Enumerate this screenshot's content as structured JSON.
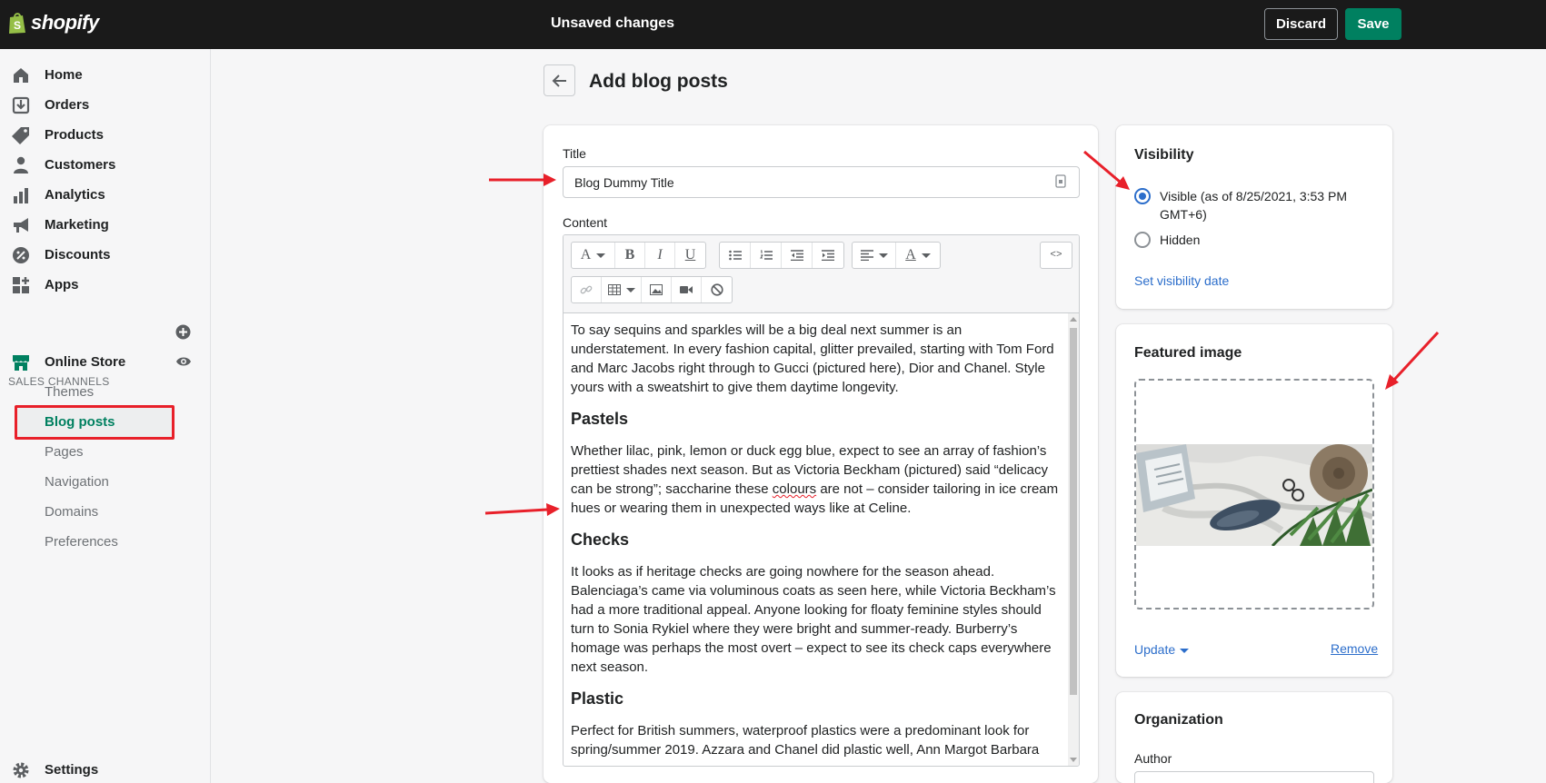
{
  "topbar": {
    "logo_text": "shopify",
    "status": "Unsaved changes",
    "discard_label": "Discard",
    "save_label": "Save"
  },
  "sidebar": {
    "items": [
      {
        "label": "Home",
        "icon": "home-icon"
      },
      {
        "label": "Orders",
        "icon": "orders-icon"
      },
      {
        "label": "Products",
        "icon": "tag-icon"
      },
      {
        "label": "Customers",
        "icon": "person-icon"
      },
      {
        "label": "Analytics",
        "icon": "bar-chart-icon"
      },
      {
        "label": "Marketing",
        "icon": "megaphone-icon"
      },
      {
        "label": "Discounts",
        "icon": "discount-icon"
      },
      {
        "label": "Apps",
        "icon": "apps-icon"
      }
    ],
    "sales_channels_label": "SALES CHANNELS",
    "online_store_label": "Online Store",
    "online_store_sub": [
      "Themes",
      "Blog posts",
      "Pages",
      "Navigation",
      "Domains",
      "Preferences"
    ],
    "active_sub": "Blog posts",
    "settings_label": "Settings"
  },
  "page": {
    "title": "Add blog posts"
  },
  "main": {
    "title_label": "Title",
    "title_value": "Blog Dummy Title",
    "content_label": "Content",
    "content": {
      "p1": "To say sequins and sparkles will be a big deal next summer is an understatement. In every fashion capital, glitter prevailed, starting with Tom Ford and Marc Jacobs right through to Gucci (pictured here), Dior and Chanel. Style yours with a sweatshirt to give them daytime longevity.",
      "h1": "Pastels",
      "p2a": "Whether lilac, pink, lemon or duck egg blue, expect to see an array of fashion’s prettiest shades next season. But as Victoria Beckham (pictured) said “delicacy can be strong”; saccharine these ",
      "p2_spell": "colours",
      "p2b": " are not – consider tailoring in ice cream hues or wearing them in unexpected ways like at Celine.",
      "h2": "Checks",
      "p3": "It looks as if heritage checks are going nowhere for the season ahead. Balenciaga’s came via voluminous coats as seen here, while Victoria Beckham’s had a more traditional appeal. Anyone looking for floaty feminine styles should turn to Sonia Rykiel where they were bright and summer-ready. Burberry’s homage was perhaps the most overt – expect to see its check caps everywhere next season.",
      "h3": "Plastic",
      "p4": "Perfect for British summers, waterproof plastics were a predominant look for spring/summer 2019. Azzara and Chanel did plastic well, Ann Margot Barbara"
    }
  },
  "visibility": {
    "title": "Visibility",
    "visible_label": "Visible (as of 8/25/2021, 3:53 PM GMT+6)",
    "visible_line1": "Visible (as of 8/25/2021, 3:53 PM",
    "visible_line2": "GMT+6)",
    "hidden_label": "Hidden",
    "selected": "Visible",
    "set_date_link": "Set visibility date"
  },
  "featured_image": {
    "title": "Featured image",
    "update_label": "Update",
    "remove_label": "Remove"
  },
  "organization": {
    "title": "Organization",
    "author_label": "Author"
  },
  "colors": {
    "topbar": "#1a1a1a",
    "primary": "#008060",
    "link": "#2c6ecb",
    "annotation": "#e8202a"
  }
}
